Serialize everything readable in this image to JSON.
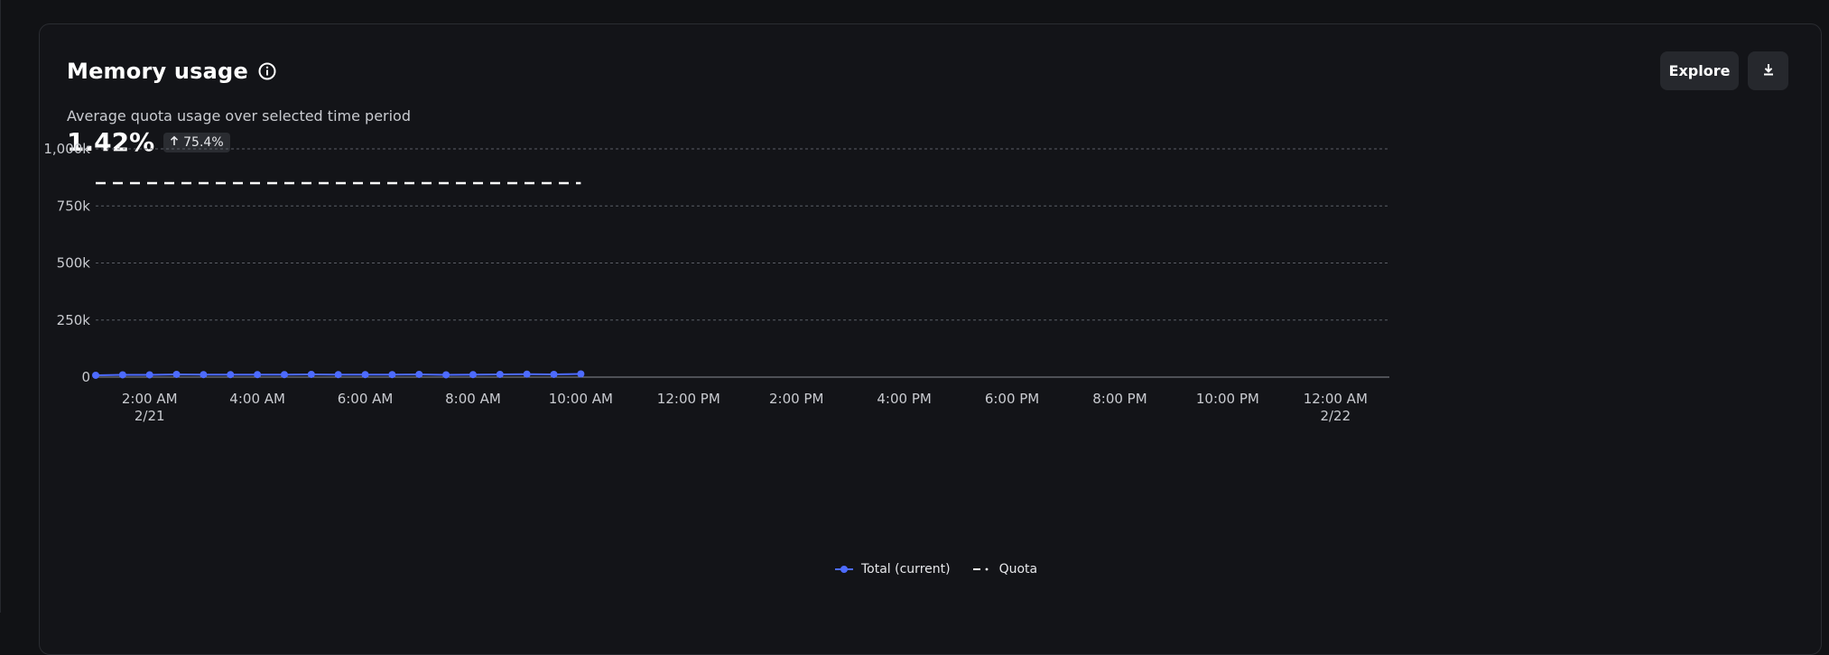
{
  "panel": {
    "title": "Memory usage",
    "subtitle": "Average quota usage over selected time period",
    "metric_value": "1.42%",
    "delta_value": "75.4%",
    "explore_label": "Explore",
    "info_icon": "info-icon",
    "download_icon": "download-icon",
    "delta_icon": "arrow-up-icon"
  },
  "colors": {
    "total": "#4d6bff",
    "quota": "#ffffff",
    "grid": "#5b5e66",
    "background": "#131418"
  },
  "chart_data": {
    "type": "line",
    "ylim": [
      0,
      1000000
    ],
    "y_ticks": [
      {
        "value": 1000000,
        "label": "1,000k"
      },
      {
        "value": 750000,
        "label": "750k"
      },
      {
        "value": 500000,
        "label": "500k"
      },
      {
        "value": 250000,
        "label": "250k"
      },
      {
        "value": 0,
        "label": "0"
      }
    ],
    "x_range": [
      "2026-02-21T01:00",
      "2026-02-22T01:00"
    ],
    "x_ticks": [
      {
        "time": "2026-02-21T02:00",
        "label": "2:00 AM",
        "sublabel": "2/21"
      },
      {
        "time": "2026-02-21T04:00",
        "label": "4:00 AM"
      },
      {
        "time": "2026-02-21T06:00",
        "label": "6:00 AM"
      },
      {
        "time": "2026-02-21T08:00",
        "label": "8:00 AM"
      },
      {
        "time": "2026-02-21T10:00",
        "label": "10:00 AM"
      },
      {
        "time": "2026-02-21T12:00",
        "label": "12:00 PM"
      },
      {
        "time": "2026-02-21T14:00",
        "label": "2:00 PM"
      },
      {
        "time": "2026-02-21T16:00",
        "label": "4:00 PM"
      },
      {
        "time": "2026-02-21T18:00",
        "label": "6:00 PM"
      },
      {
        "time": "2026-02-21T20:00",
        "label": "8:00 PM"
      },
      {
        "time": "2026-02-21T22:00",
        "label": "10:00 PM"
      },
      {
        "time": "2026-02-22T00:00",
        "label": "12:00 AM",
        "sublabel": "2/22"
      }
    ],
    "series": [
      {
        "name": "Total (current)",
        "style": "line-markers",
        "points": [
          {
            "x": "2026-02-21T01:00",
            "y": 8000
          },
          {
            "x": "2026-02-21T01:30",
            "y": 10000
          },
          {
            "x": "2026-02-21T02:00",
            "y": 10000
          },
          {
            "x": "2026-02-21T02:30",
            "y": 12000
          },
          {
            "x": "2026-02-21T03:00",
            "y": 11000
          },
          {
            "x": "2026-02-21T03:30",
            "y": 11000
          },
          {
            "x": "2026-02-21T04:00",
            "y": 11000
          },
          {
            "x": "2026-02-21T04:30",
            "y": 11000
          },
          {
            "x": "2026-02-21T05:00",
            "y": 12000
          },
          {
            "x": "2026-02-21T05:30",
            "y": 11000
          },
          {
            "x": "2026-02-21T06:00",
            "y": 11000
          },
          {
            "x": "2026-02-21T06:30",
            "y": 11000
          },
          {
            "x": "2026-02-21T07:00",
            "y": 12000
          },
          {
            "x": "2026-02-21T07:30",
            "y": 10000
          },
          {
            "x": "2026-02-21T08:00",
            "y": 11000
          },
          {
            "x": "2026-02-21T08:30",
            "y": 12000
          },
          {
            "x": "2026-02-21T09:00",
            "y": 13000
          },
          {
            "x": "2026-02-21T09:30",
            "y": 12000
          },
          {
            "x": "2026-02-21T10:00",
            "y": 14000
          }
        ]
      },
      {
        "name": "Quota",
        "style": "dashed",
        "points": [
          {
            "x": "2026-02-21T01:00",
            "y": 850000
          },
          {
            "x": "2026-02-21T10:00",
            "y": 850000
          }
        ]
      }
    ],
    "grid": true,
    "legend_position": "bottom-center"
  }
}
